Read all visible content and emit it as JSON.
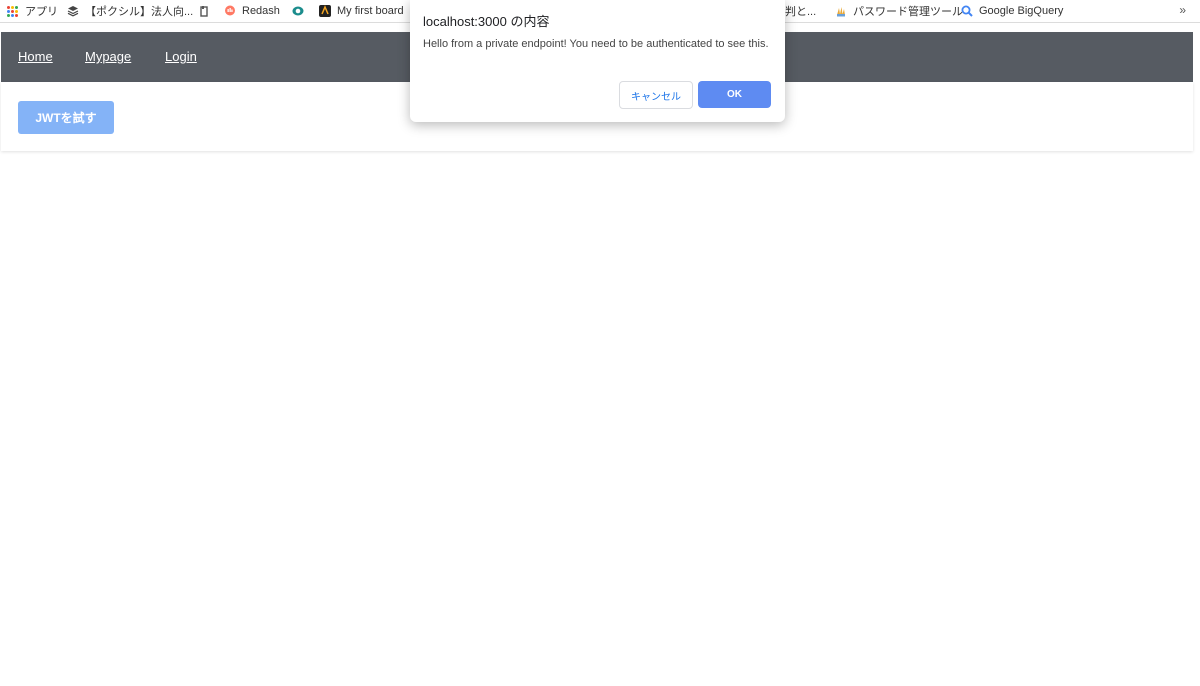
{
  "bookmarks": {
    "items": [
      {
        "label": "アプリ",
        "icon": "apps-grid-icon"
      },
      {
        "label": "【ポクシル】法人向...",
        "icon": "layers-icon"
      },
      {
        "label": "",
        "icon": "bookmark-icon"
      },
      {
        "label": "Redash",
        "icon": "redash-icon"
      },
      {
        "label": "",
        "icon": "eye-icon"
      },
      {
        "label": "My first board",
        "icon": "board-icon"
      },
      {
        "label": "判と...",
        "icon": ""
      },
      {
        "label": "パスワード管理ツール",
        "icon": "hand-icon"
      },
      {
        "label": "Google BigQuery",
        "icon": "search-icon"
      }
    ],
    "more": "»"
  },
  "nav": {
    "home": "Home",
    "mypage": "Mypage",
    "login": "Login"
  },
  "main": {
    "jwt_button": "JWTを試す"
  },
  "dialog": {
    "title": "localhost:3000 の内容",
    "message": "Hello from a private endpoint! You need to be authenticated to see this.",
    "cancel": "キャンセル",
    "ok": "OK"
  },
  "colors": {
    "navbar": "#565b62",
    "jwt_button": "#84b3f7",
    "ok_button": "#5e8bf2",
    "cancel_text": "#1a73e8"
  }
}
